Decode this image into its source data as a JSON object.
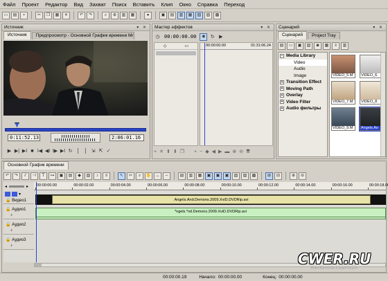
{
  "menu": [
    "Файл",
    "Проект",
    "Редактор",
    "Вид",
    "Захват",
    "Поиск",
    "Вставить",
    "Клип",
    "Окно",
    "Справка",
    "Переход"
  ],
  "source_panel": {
    "title": "Источник",
    "tabs": [
      "Источник",
      "Предпросмотр - Основной График времени Mr"
    ],
    "timecode_in": "0:11:52.13",
    "timecode_out": "2:06:01.16"
  },
  "effects_panel": {
    "title": "Мастер эффектов",
    "timecode": "00:00:00.00",
    "ruler_start": "00:00:00.00",
    "ruler_end": "01:31:06.24"
  },
  "scenario_panel": {
    "title": "Сценарий",
    "tabs": [
      "Сценарий",
      "Project Tray"
    ],
    "tree": [
      {
        "label": "Media Library",
        "level": 0,
        "expanded": true
      },
      {
        "label": "Video",
        "level": 1
      },
      {
        "label": "Audio",
        "level": 1
      },
      {
        "label": "Image",
        "level": 1
      },
      {
        "label": "Transition Effect",
        "level": 0
      },
      {
        "label": "Moving Path",
        "level": 0
      },
      {
        "label": "Overlay",
        "level": 0
      },
      {
        "label": "Video Filter",
        "level": 0
      },
      {
        "label": "Audio фильтры",
        "level": 0
      }
    ],
    "thumbnails": [
      "VIDEO_5.M",
      "VIDEO_6.",
      "VIDEO_7.M",
      "VIDEO_8.",
      "VIDEO_9.M",
      "Angels.An"
    ]
  },
  "timeline": {
    "title": "Основной График времени",
    "ruler": [
      "00:00:00.00",
      "00:00:02.00",
      "00:00:04.00",
      "00:00:06.00",
      "00:00:08.00",
      "00:00:10.00",
      "00:00:12.00",
      "00:00:14.00",
      "00:00:16.00",
      "00:00:18.00"
    ],
    "tracks": [
      {
        "name": "Видео1",
        "clip": "Angels.And.Demons.2009.XviD.DVDRip.avi"
      },
      {
        "name": "Аудио1",
        "clip": "*ngels.*nd.Demons.2009.XviD.DVDRip.avi"
      },
      {
        "name": "Аудио2",
        "clip": ""
      },
      {
        "name": "Аудио3",
        "clip": ""
      }
    ]
  },
  "status": {
    "time": "00:00:00.19",
    "start_label": "Начало:",
    "start_value": "00:00:00.00",
    "end_label": "Конец:",
    "end_value": "00:00:00.00"
  },
  "watermark": "CWER.RU",
  "watermark_sub": "Ваш навигатор в мире софта",
  "colors": {
    "video_clip": "#e7e2a8",
    "audio_clip": "#c8f0c0",
    "playhead": "#2a44c8"
  }
}
